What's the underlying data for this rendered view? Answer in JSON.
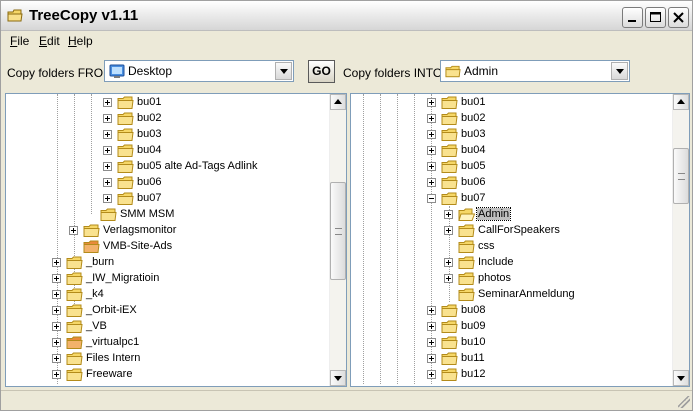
{
  "window": {
    "title": "TreeCopy v1.11"
  },
  "menu": [
    {
      "first": "F",
      "rest": "ile"
    },
    {
      "first": "E",
      "rest": "dit"
    },
    {
      "first": "H",
      "rest": "elp"
    }
  ],
  "toolbar": {
    "from_label": "Copy folders FROM",
    "from_value": "Desktop",
    "go_label": "GO",
    "into_label": "Copy folders INTO",
    "into_value": "Admin"
  },
  "left_tree": [
    {
      "label": "bu01",
      "expander": "plus",
      "icon": "folder"
    },
    {
      "label": "bu02",
      "expander": "plus",
      "icon": "folder"
    },
    {
      "label": "bu03",
      "expander": "plus",
      "icon": "folder"
    },
    {
      "label": "bu04",
      "expander": "plus",
      "icon": "folder"
    },
    {
      "label": "bu05 alte Ad-Tags Adlink",
      "expander": "plus",
      "icon": "folder"
    },
    {
      "label": "bu06",
      "expander": "plus",
      "icon": "folder"
    },
    {
      "label": "bu07",
      "expander": "plus",
      "icon": "folder"
    },
    {
      "label": "SMM MSM",
      "expander": "none",
      "icon": "folder"
    },
    {
      "label": "Verlagsmonitor",
      "expander": "plus",
      "icon": "folder"
    },
    {
      "label": "VMB-Site-Ads",
      "expander": "none",
      "icon": "folder-special"
    },
    {
      "label": "_burn",
      "expander": "plus",
      "icon": "folder"
    },
    {
      "label": "_IW_Migratioin",
      "expander": "plus",
      "icon": "folder"
    },
    {
      "label": "_k4",
      "expander": "plus",
      "icon": "folder"
    },
    {
      "label": "_Orbit-iEX",
      "expander": "plus",
      "icon": "folder"
    },
    {
      "label": "_VB",
      "expander": "plus",
      "icon": "folder"
    },
    {
      "label": "_virtualpc1",
      "expander": "plus",
      "icon": "folder-special"
    },
    {
      "label": "Files Intern",
      "expander": "plus",
      "icon": "folder"
    },
    {
      "label": "Freeware",
      "expander": "plus",
      "icon": "folder"
    }
  ],
  "right_tree": [
    {
      "label": "bu01",
      "expander": "plus",
      "icon": "folder"
    },
    {
      "label": "bu02",
      "expander": "plus",
      "icon": "folder"
    },
    {
      "label": "bu03",
      "expander": "plus",
      "icon": "folder"
    },
    {
      "label": "bu04",
      "expander": "plus",
      "icon": "folder"
    },
    {
      "label": "bu05",
      "expander": "plus",
      "icon": "folder"
    },
    {
      "label": "bu06",
      "expander": "plus",
      "icon": "folder"
    },
    {
      "label": "bu07",
      "expander": "minus",
      "icon": "folder"
    },
    {
      "label": "Admin",
      "expander": "plus",
      "icon": "folder-open",
      "selected": true
    },
    {
      "label": "CallForSpeakers",
      "expander": "plus",
      "icon": "folder"
    },
    {
      "label": "css",
      "expander": "none",
      "icon": "folder"
    },
    {
      "label": "Include",
      "expander": "plus",
      "icon": "folder"
    },
    {
      "label": "photos",
      "expander": "plus",
      "icon": "folder"
    },
    {
      "label": "SeminarAnmeldung",
      "expander": "none",
      "icon": "folder"
    },
    {
      "label": "bu08",
      "expander": "plus",
      "icon": "folder"
    },
    {
      "label": "bu09",
      "expander": "plus",
      "icon": "folder"
    },
    {
      "label": "bu10",
      "expander": "plus",
      "icon": "folder"
    },
    {
      "label": "bu11",
      "expander": "plus",
      "icon": "folder"
    },
    {
      "label": "bu12",
      "expander": "plus",
      "icon": "folder"
    }
  ],
  "colors": {
    "folder_fill": "#f6d767",
    "folder_stroke": "#b38b1a",
    "selection": "#c0c0c0"
  }
}
